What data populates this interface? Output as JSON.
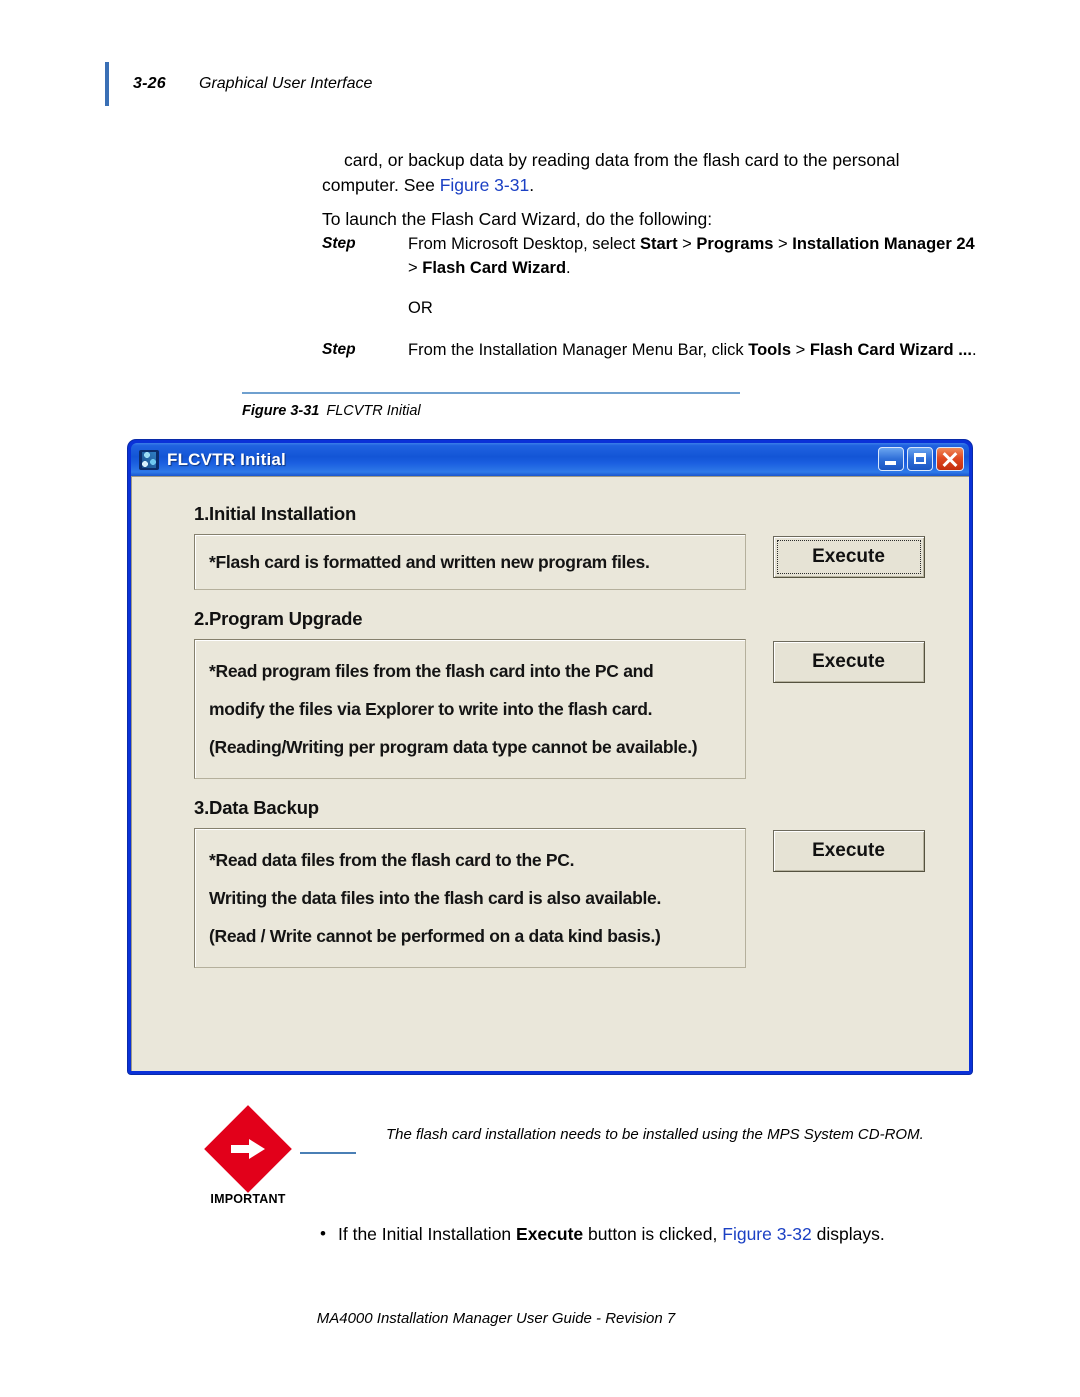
{
  "header": {
    "page_number": "3-26",
    "title": "Graphical User Interface"
  },
  "body": {
    "paragraph_1_part1": "card, or backup data by reading data from the flash card to the personal computer. See ",
    "paragraph_1_link": "Figure 3-31",
    "paragraph_1_part2": ".",
    "paragraph_2": "To launch the Flash Card Wizard, do the following:"
  },
  "steps": [
    {
      "label": "Step",
      "text_part1": "From Microsoft Desktop, select ",
      "bold1": "Start",
      "sep1": " > ",
      "bold2": "Programs",
      "sep2": " > ",
      "bold3": "Installation Manager 24",
      "sep3": " > ",
      "bold4": "Flash Card Wizard",
      "tail": "."
    },
    {
      "label": "Step",
      "text_part1": "From the Installation Manager Menu Bar, click ",
      "bold1": "Tools",
      "sep1": " > ",
      "bold2": "Flash Card Wizard ...",
      "tail": "."
    }
  ],
  "or_text": "OR",
  "figure": {
    "number": "Figure 3-31",
    "title": "FLCVTR Initial"
  },
  "window": {
    "title": "FLCVTR Initial",
    "icon": "application-icon",
    "controls": {
      "minimize": "minimize-button",
      "maximize": "maximize-button",
      "close": "close-button"
    },
    "sections": [
      {
        "heading": "1.Initial Installation",
        "lines": [
          "*Flash card is formatted and written new program files."
        ],
        "button": "Execute",
        "focused": true
      },
      {
        "heading": "2.Program Upgrade",
        "lines": [
          "*Read program files from the flash card into the PC and",
          "modify the files via Explorer to write into the flash card.",
          "(Reading/Writing per program data type cannot be available.)"
        ],
        "button": "Execute",
        "focused": false
      },
      {
        "heading": "3.Data Backup",
        "lines": [
          "*Read data files from the flash card to the PC.",
          "Writing the data files into the flash card is also available.",
          "(Read / Write cannot be performed on a data kind basis.)"
        ],
        "button": "Execute",
        "focused": false
      }
    ]
  },
  "callout": {
    "label": "IMPORTANT",
    "text": "The flash card installation needs to be installed using the MPS System CD-ROM."
  },
  "bullet": {
    "dot": "•",
    "part1": "If the Initial Installation ",
    "bold": "Execute",
    "part2": " button is clicked, ",
    "link": "Figure 3-32",
    "part3": " displays."
  },
  "footer": {
    "text": "MA4000 Installation Manager User Guide - Revision 7"
  },
  "colors": {
    "link": "#1b40c4",
    "header_rule": "#3a6fb5",
    "figure_rule": "#6fa0cf",
    "window_border": "#0a31d8",
    "dialog_face": "#eae7da",
    "important_red": "#e2001a"
  }
}
